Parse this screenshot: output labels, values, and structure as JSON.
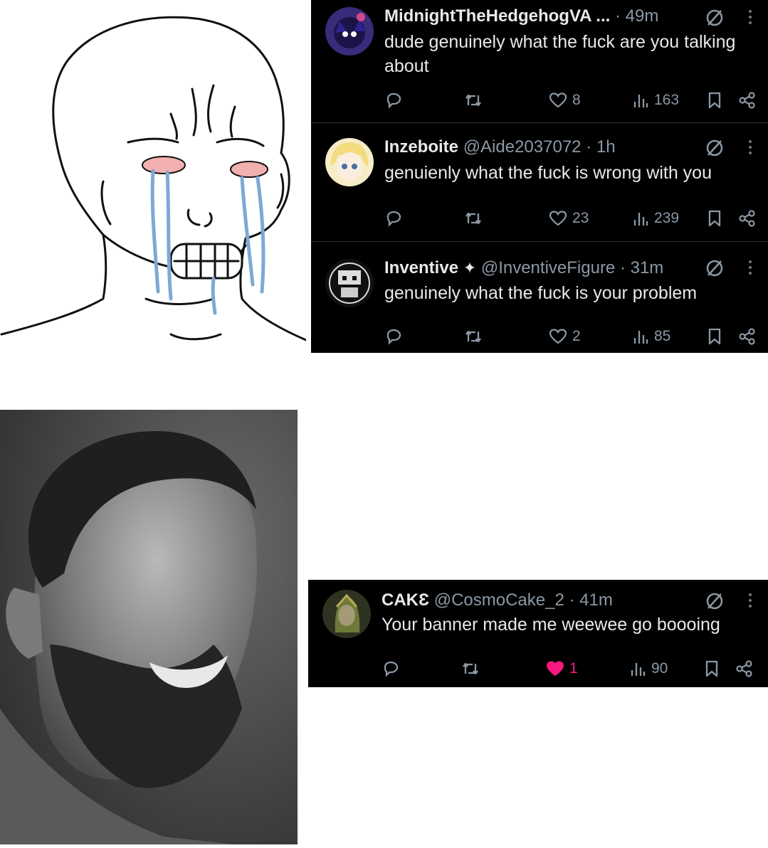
{
  "tweets": [
    {
      "display_name": "MidnightTheHedgehogVA ...",
      "handle": "",
      "time": "· 49m",
      "text": "dude genuinely what the fuck are you talking about",
      "likes": "8",
      "views": "163",
      "liked": false,
      "avatar_icon": "hedgehog-avatar"
    },
    {
      "display_name": "Inzeboite",
      "handle": "@Aide2037072",
      "time": "· 1h",
      "text": "genuienly what the fuck is wrong with you",
      "likes": "23",
      "views": "239",
      "liked": false,
      "avatar_icon": "anime-girl-avatar"
    },
    {
      "display_name": "Inventive",
      "verified_mark": "✦",
      "handle": "@InventiveFigure",
      "time": "· 31m",
      "text": "genuinely what the fuck is your problem",
      "likes": "2",
      "views": "85",
      "liked": false,
      "avatar_icon": "pixel-character-avatar"
    },
    {
      "display_name": "CAKƐ",
      "handle": "@CosmoCake_2",
      "time": "· 41m",
      "text": "Your banner made me weewee go boooing",
      "likes": "1",
      "views": "90",
      "liked": true,
      "avatar_icon": "armored-figure-avatar"
    }
  ],
  "colors": {
    "background": "#000000",
    "text": "#e7e9ea",
    "muted": "#8b98a5",
    "like_active": "#f91880",
    "divider": "#2f3336"
  },
  "images": {
    "top_left": "crying-wojak-drawing",
    "bottom_left": "smiling-bearded-man-photo"
  }
}
